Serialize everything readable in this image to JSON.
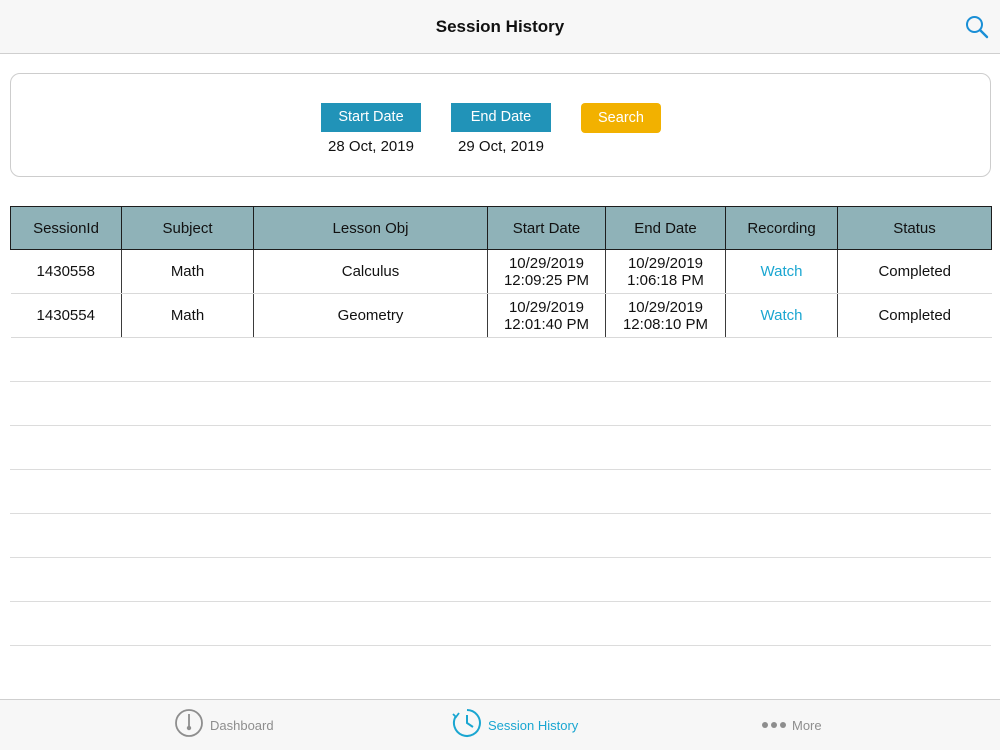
{
  "header": {
    "title": "Session History"
  },
  "filter": {
    "start_label": "Start Date",
    "start_value": "28 Oct, 2019",
    "end_label": "End Date",
    "end_value": "29 Oct, 2019",
    "search_label": "Search"
  },
  "table": {
    "columns": [
      "SessionId",
      "Subject",
      "Lesson Obj",
      "Start Date",
      "End Date",
      "Recording",
      "Status"
    ],
    "rows": [
      {
        "session_id": "1430558",
        "subject": "Math",
        "lesson_obj": "Calculus",
        "start_date": "10/29/2019",
        "start_time": "12:09:25 PM",
        "end_date": "10/29/2019",
        "end_time": "1:06:18 PM",
        "recording": "Watch",
        "status": "Completed"
      },
      {
        "session_id": "1430554",
        "subject": "Math",
        "lesson_obj": "Geometry",
        "start_date": "10/29/2019",
        "start_time": "12:01:40 PM",
        "end_date": "10/29/2019",
        "end_time": "12:08:10 PM",
        "recording": "Watch",
        "status": "Completed"
      }
    ]
  },
  "tabbar": {
    "tabs": [
      {
        "label": "Dashboard",
        "icon": "gauge-icon"
      },
      {
        "label": "Session History",
        "icon": "clock-icon"
      },
      {
        "label": "More",
        "icon": "more-dots-icon"
      }
    ]
  },
  "colors": {
    "accent": "#1aa6d1",
    "date_button": "#2193b8",
    "search_button": "#f2b100",
    "table_header": "#8fb2b8"
  }
}
